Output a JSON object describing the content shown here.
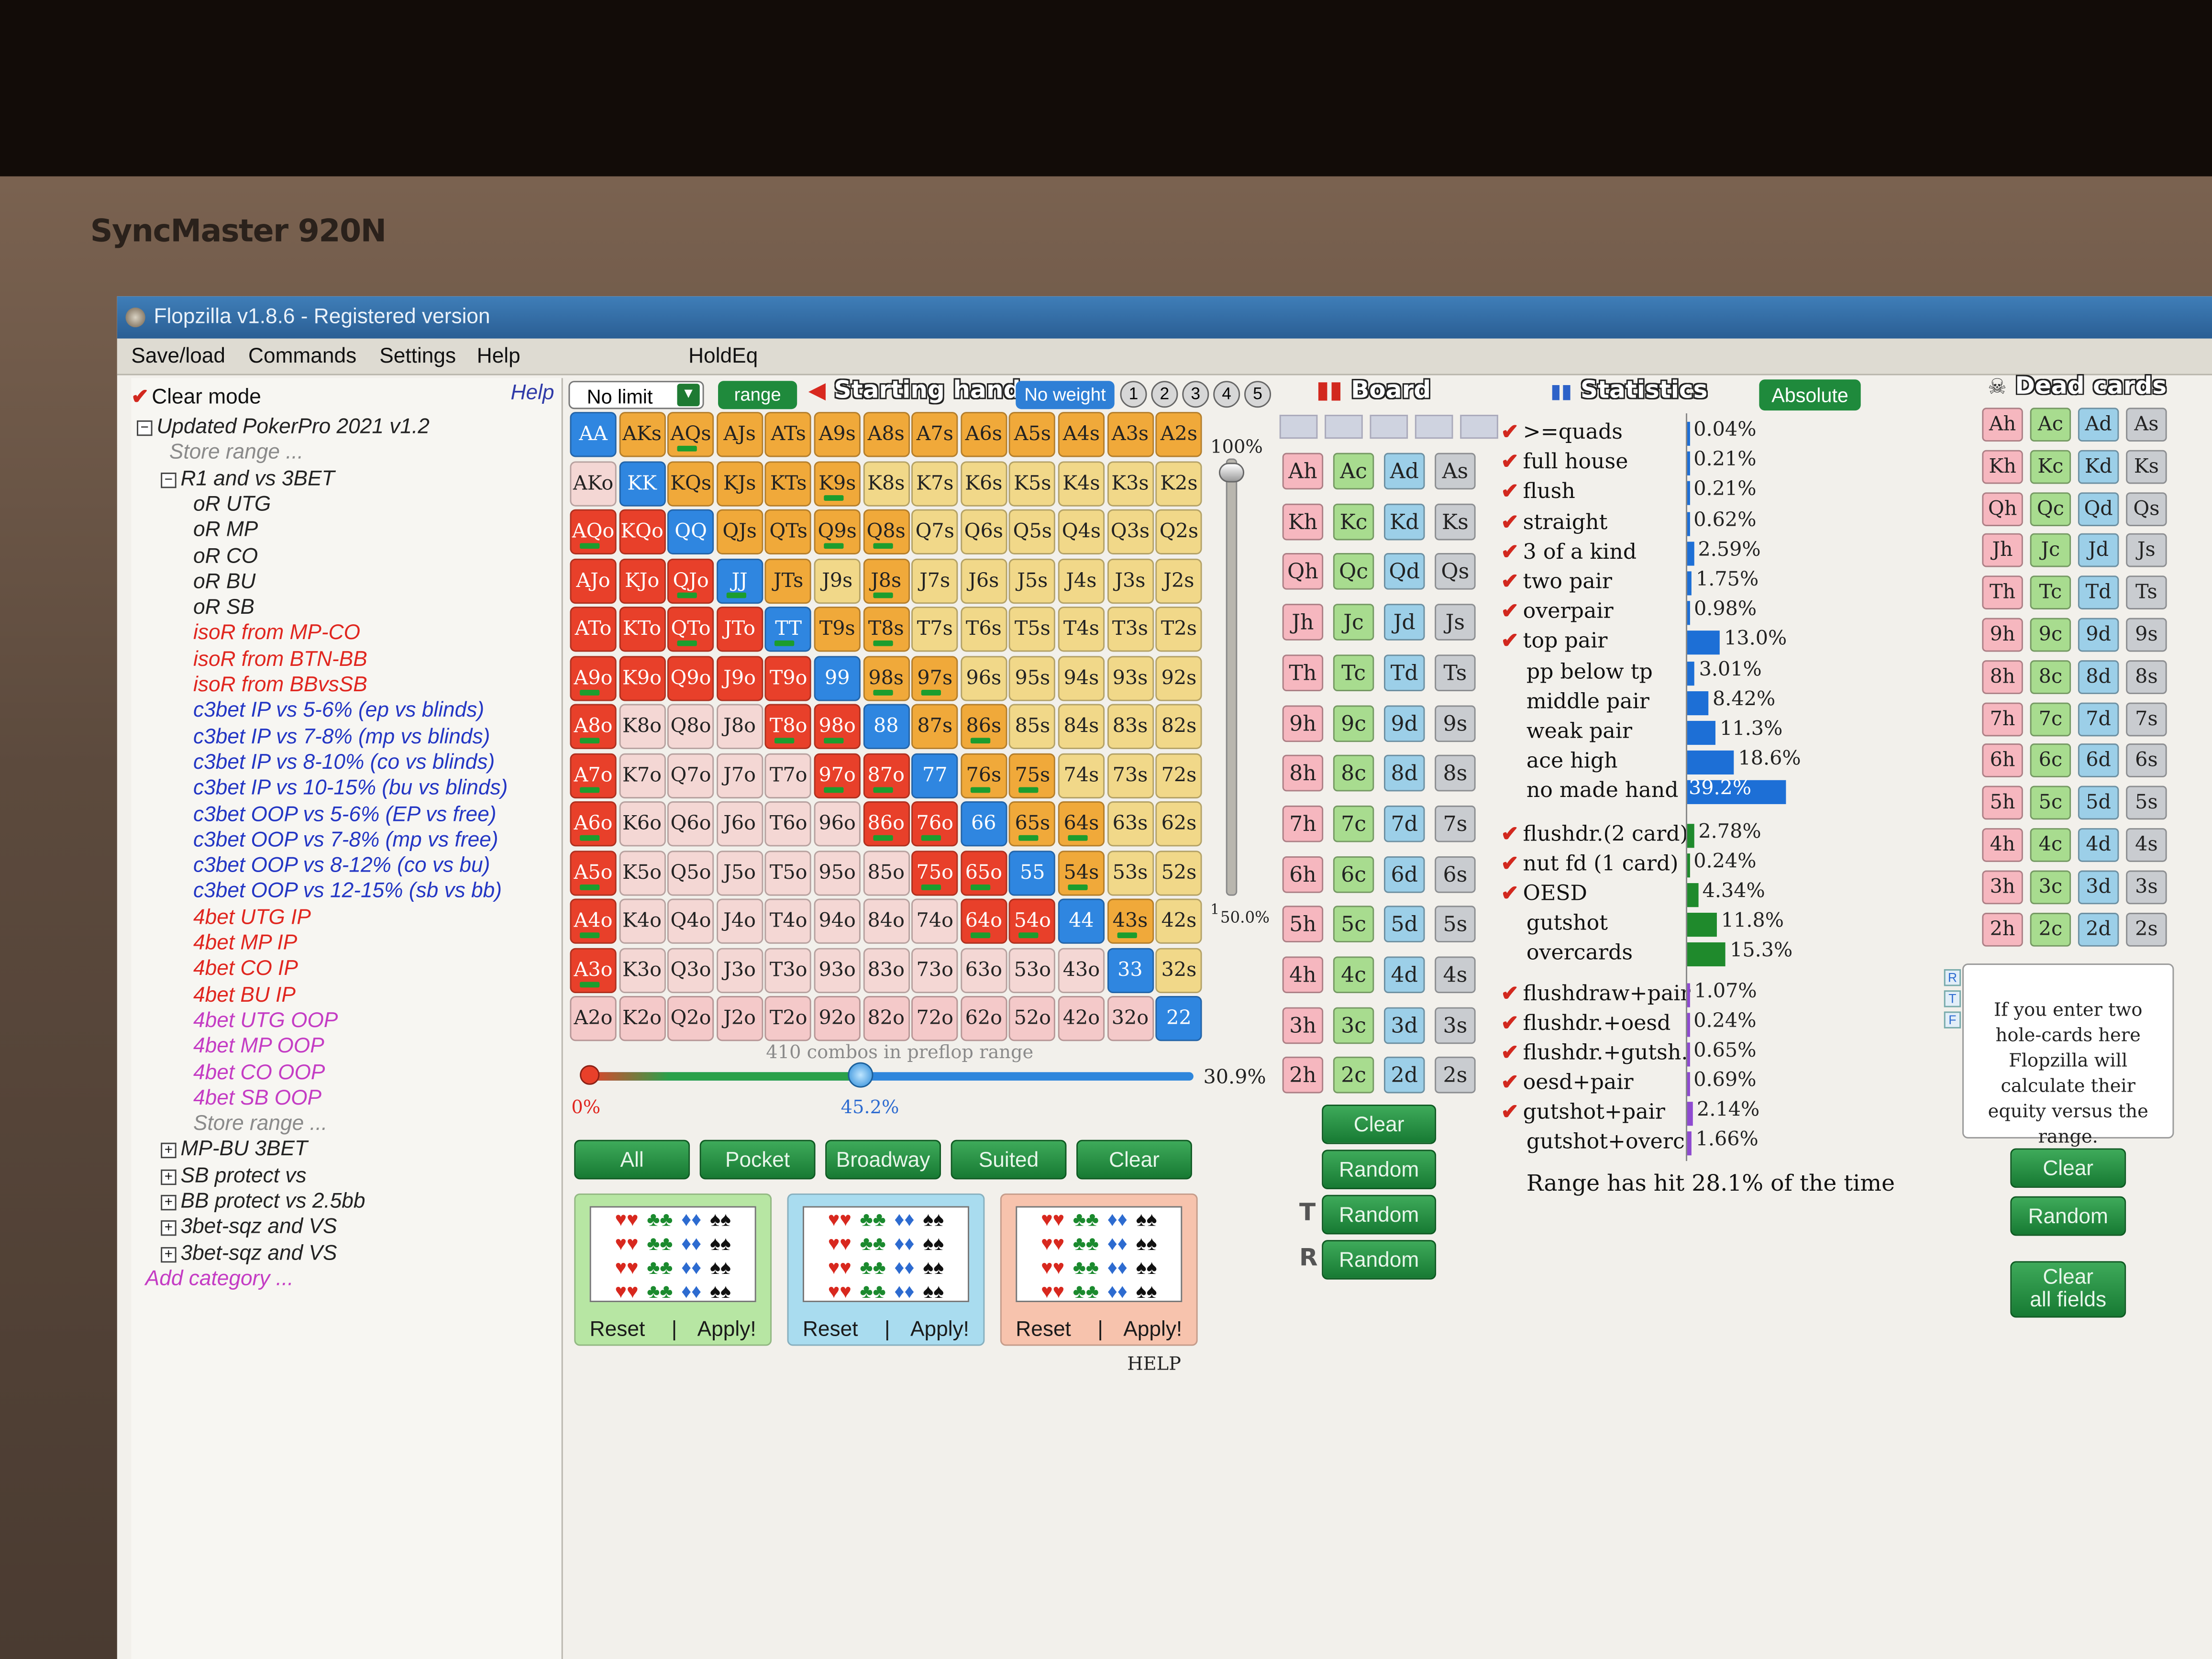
{
  "monitor": {
    "brand": "SyncMaster 920N"
  },
  "window": {
    "title": "Flopzilla v1.8.6 - Registered version"
  },
  "menu": [
    "Save/load",
    "Commands",
    "Settings",
    "Help",
    "HoldEq"
  ],
  "left_panel": {
    "clear_mode": "Clear mode",
    "help": "Help",
    "tree": [
      {
        "text": "Updated PokerPro 2021 v1.2",
        "color": "dark",
        "indent": 0,
        "box": "minus"
      },
      {
        "text": "Store range ...",
        "color": "gray",
        "indent": 1,
        "box": ""
      },
      {
        "text": "R1 and vs 3BET",
        "color": "dark",
        "indent": 1,
        "box": "minus"
      },
      {
        "text": "oR UTG",
        "color": "dark",
        "indent": 2,
        "box": ""
      },
      {
        "text": "oR MP",
        "color": "dark",
        "indent": 2,
        "box": ""
      },
      {
        "text": "oR CO",
        "color": "dark",
        "indent": 2,
        "box": ""
      },
      {
        "text": "oR BU",
        "color": "dark",
        "indent": 2,
        "box": ""
      },
      {
        "text": "oR SB",
        "color": "dark",
        "indent": 2,
        "box": ""
      },
      {
        "text": "isoR from MP-CO",
        "color": "red",
        "indent": 2,
        "box": ""
      },
      {
        "text": "isoR from BTN-BB",
        "color": "red",
        "indent": 2,
        "box": ""
      },
      {
        "text": "isoR from BBvsSB",
        "color": "red",
        "indent": 2,
        "box": ""
      },
      {
        "text": "c3bet IP vs 5-6% (ep vs blinds)",
        "color": "blue",
        "indent": 2,
        "box": ""
      },
      {
        "text": "c3bet IP vs 7-8% (mp vs blinds)",
        "color": "blue",
        "indent": 2,
        "box": ""
      },
      {
        "text": "c3bet IP vs 8-10% (co vs blinds)",
        "color": "blue",
        "indent": 2,
        "box": ""
      },
      {
        "text": "c3bet IP vs 10-15% (bu vs blinds)",
        "color": "blue",
        "indent": 2,
        "box": ""
      },
      {
        "text": "c3bet OOP vs 5-6% (EP vs free)",
        "color": "blue",
        "indent": 2,
        "box": ""
      },
      {
        "text": "c3bet OOP vs 7-8% (mp vs free)",
        "color": "blue",
        "indent": 2,
        "box": ""
      },
      {
        "text": "c3bet OOP vs 8-12% (co vs bu)",
        "color": "blue",
        "indent": 2,
        "box": ""
      },
      {
        "text": "c3bet OOP vs 12-15% (sb vs bb)",
        "color": "blue",
        "indent": 2,
        "box": ""
      },
      {
        "text": "4bet UTG IP",
        "color": "red",
        "indent": 2,
        "box": ""
      },
      {
        "text": "4bet MP IP",
        "color": "red",
        "indent": 2,
        "box": ""
      },
      {
        "text": "4bet CO IP",
        "color": "red",
        "indent": 2,
        "box": ""
      },
      {
        "text": "4bet BU IP",
        "color": "red",
        "indent": 2,
        "box": ""
      },
      {
        "text": "4bet UTG OOP",
        "color": "pink",
        "indent": 2,
        "box": ""
      },
      {
        "text": "4bet MP OOP",
        "color": "pink",
        "indent": 2,
        "box": ""
      },
      {
        "text": "4bet CO OOP",
        "color": "pink",
        "indent": 2,
        "box": ""
      },
      {
        "text": "4bet SB OOP",
        "color": "pink",
        "indent": 2,
        "box": ""
      },
      {
        "text": "Store range ...",
        "color": "gray",
        "indent": 2,
        "box": ""
      },
      {
        "text": "MP-BU 3BET",
        "color": "dark",
        "indent": 1,
        "box": "plus"
      },
      {
        "text": "SB protect vs",
        "color": "dark",
        "indent": 1,
        "box": "plus"
      },
      {
        "text": "BB protect vs 2.5bb",
        "color": "dark",
        "indent": 1,
        "box": "plus"
      },
      {
        "text": "3bet-sqz and VS",
        "color": "dark",
        "indent": 1,
        "box": "plus"
      },
      {
        "text": "3bet-sqz and VS",
        "color": "dark",
        "indent": 1,
        "box": "plus"
      },
      {
        "text": "Add category ...",
        "color": "pink",
        "indent": 0,
        "box": ""
      }
    ]
  },
  "range_panel": {
    "game_type": "No limit",
    "range_btn": "range",
    "title": "Starting hand",
    "weight_btn": "No weight",
    "weight_levels": [
      "1",
      "2",
      "3",
      "4",
      "5"
    ],
    "combos_text": "410 combos in preflop range",
    "slider_min": "0%",
    "slider_value": "45.2%",
    "slider_right": "30.9%",
    "slider_fraction": 0.452,
    "vslider_top": "100%",
    "vslider_bottom": "50.0%",
    "vslider_small": "1",
    "buttons": [
      "All",
      "Pocket",
      "Broadway",
      "Suited",
      "Clear"
    ],
    "suit_panels": [
      {
        "reset": "Reset",
        "apply": "Apply!",
        "bg": "#b7e6a3"
      },
      {
        "reset": "Reset",
        "apply": "Apply!",
        "bg": "#a9dcef"
      },
      {
        "reset": "Reset",
        "apply": "Apply!",
        "bg": "#f7c3ad"
      }
    ],
    "help": "HELP",
    "colors": {
      "r": "#e8402a",
      "o": "#f0a93a",
      "b": "#2f86e0",
      "p": "#f4c9c9",
      "y": "#f1d889",
      "w": "#f4d7d4"
    },
    "rows": [
      "AA AKs AQs AJs ATs A9s A8s A7s A6s A5s A4s A3s A2s",
      "AKo KK KQs KJs KTs K9s K8s K7s K6s K5s K4s K3s K2s",
      "AQo KQo QQ QJs QTs Q9s Q8s Q7s Q6s Q5s Q4s Q3s Q2s",
      "AJo KJo QJo JJ JTs J9s J8s J7s J6s J5s J4s J3s J2s",
      "ATo KTo QTo JTo TT T9s T8s T7s T6s T5s T4s T3s T2s",
      "A9o K9o Q9o J9o T9o 99 98s 97s 96s 95s 94s 93s 92s",
      "A8o K8o Q8o J8o T8o 98o 88 87s 86s 85s 84s 83s 82s",
      "A7o K7o Q7o J7o T7o 97o 87o 77 76s 75s 74s 73s 72s",
      "A6o K6o Q6o J6o T6o 96o 86o 76o 66 65s 64s 63s 62s",
      "A5o K5o Q5o J5o T5o 95o 85o 75o 65o 55 54s 53s 52s",
      "A4o K4o Q4o J4o T4o 94o 84o 74o 64o 54o 44 43s 42s",
      "A3o K3o Q3o J3o T3o 93o 83o 73o 63o 53o 43o 33 32s",
      "A2o K2o Q2o J2o T2o 92o 82o 72o 62o 52o 42o 32o 22"
    ],
    "row_colors": [
      "b o o o o o o o o o o o o",
      "w b o o o o y y y y y y y",
      "r r b o o o o y y y y y y",
      "r r r b o y o y y y y y y",
      "r r r r b o o y y y y y y",
      "r r r r r b o o y y y y y",
      "r w w w r r b o o y y y y",
      "r w w w w r r b o o y y y",
      "r w w w w w r r b o o y y",
      "r w w w w w w r r b o y y",
      "r w w w w w w w r r b o y",
      "r w w w w w w w w w w b y",
      "p p p p p p p p p p p p b"
    ],
    "row_dash": [
      "0 0 1 0 0 0 0 0 0 0 0 0 0",
      "0 0 0 0 0 1 0 0 0 0 0 0 0",
      "1 0 0 0 0 1 1 0 0 0 0 0 0",
      "0 0 1 1 0 0 1 0 0 0 0 0 0",
      "0 0 1 0 1 0 1 0 0 0 0 0 0",
      "1 0 0 0 0 0 1 1 0 0 0 0 0",
      "1 0 0 0 1 1 0 0 1 0 0 0 0",
      "1 0 0 0 0 1 1 0 1 1 0 0 0",
      "1 0 0 0 0 0 1 1 0 1 1 0 0",
      "1 0 0 0 0 0 0 1 1 0 1 0 0",
      "1 0 0 0 0 0 0 0 1 1 0 1 0",
      "1 0 0 0 0 0 0 0 0 0 0 0 0",
      "0 0 0 0 0 0 0 0 0 0 0 0 0"
    ]
  },
  "board": {
    "title": "Board",
    "cards": [
      [
        "Ah",
        "Ac",
        "Ad",
        "As"
      ],
      [
        "Kh",
        "Kc",
        "Kd",
        "Ks"
      ],
      [
        "Qh",
        "Qc",
        "Qd",
        "Qs"
      ],
      [
        "Jh",
        "Jc",
        "Jd",
        "Js"
      ],
      [
        "Th",
        "Tc",
        "Td",
        "Ts"
      ],
      [
        "9h",
        "9c",
        "9d",
        "9s"
      ],
      [
        "8h",
        "8c",
        "8d",
        "8s"
      ],
      [
        "7h",
        "7c",
        "7d",
        "7s"
      ],
      [
        "6h",
        "6c",
        "6d",
        "6s"
      ],
      [
        "5h",
        "5c",
        "5d",
        "5s"
      ],
      [
        "4h",
        "4c",
        "4d",
        "4s"
      ],
      [
        "3h",
        "3c",
        "3d",
        "3s"
      ],
      [
        "2h",
        "2c",
        "2d",
        "2s"
      ]
    ],
    "clear": "Clear",
    "random": "Random",
    "turn_label": "T",
    "river_label": "R",
    "turn_random": "Random",
    "river_random": "Random"
  },
  "statistics": {
    "title": "Statistics",
    "mode_btn": "Absolute",
    "group1": [
      {
        "label": ">=quads",
        "value": "0.04%",
        "pct": 0.04,
        "checked": true
      },
      {
        "label": "full house",
        "value": "0.21%",
        "pct": 0.21,
        "checked": true
      },
      {
        "label": "flush",
        "value": "0.21%",
        "pct": 0.21,
        "checked": true
      },
      {
        "label": "straight",
        "value": "0.62%",
        "pct": 0.62,
        "checked": true
      },
      {
        "label": "3 of a kind",
        "value": "2.59%",
        "pct": 2.59,
        "checked": true
      },
      {
        "label": "two pair",
        "value": "1.75%",
        "pct": 1.75,
        "checked": true
      },
      {
        "label": "overpair",
        "value": "0.98%",
        "pct": 0.98,
        "checked": true
      },
      {
        "label": "top pair",
        "value": "13.0%",
        "pct": 13.0,
        "checked": true
      },
      {
        "label": "pp below tp",
        "value": "3.01%",
        "pct": 3.01,
        "checked": false
      },
      {
        "label": "middle pair",
        "value": "8.42%",
        "pct": 8.42,
        "checked": false
      },
      {
        "label": "weak pair",
        "value": "11.3%",
        "pct": 11.3,
        "checked": false
      },
      {
        "label": "ace high",
        "value": "18.6%",
        "pct": 18.6,
        "checked": false
      },
      {
        "label": "no made hand",
        "value": "39.2%",
        "pct": 39.2,
        "checked": false
      }
    ],
    "group2": [
      {
        "label": "flushdr.(2 card)",
        "value": "2.78%",
        "pct": 2.78,
        "checked": true
      },
      {
        "label": "nut fd (1 card)",
        "value": "0.24%",
        "pct": 0.24,
        "checked": true
      },
      {
        "label": "OESD",
        "value": "4.34%",
        "pct": 4.34,
        "checked": true
      },
      {
        "label": "gutshot",
        "value": "11.8%",
        "pct": 11.8,
        "checked": false
      },
      {
        "label": "overcards",
        "value": "15.3%",
        "pct": 15.3,
        "checked": false
      }
    ],
    "group3": [
      {
        "label": "flushdraw+pair",
        "value": "1.07%",
        "pct": 1.07,
        "checked": true
      },
      {
        "label": "flushdr.+oesd",
        "value": "0.24%",
        "pct": 0.24,
        "checked": true
      },
      {
        "label": "flushdr.+gutsh.",
        "value": "0.65%",
        "pct": 0.65,
        "checked": true
      },
      {
        "label": "oesd+pair",
        "value": "0.69%",
        "pct": 0.69,
        "checked": true
      },
      {
        "label": "gutshot+pair",
        "value": "2.14%",
        "pct": 2.14,
        "checked": true
      },
      {
        "label": "gutshot+overc.",
        "value": "1.66%",
        "pct": 1.66,
        "checked": false
      }
    ],
    "summary": "Range has hit 28.1% of the time"
  },
  "dead_cards": {
    "title": "Dead cards",
    "info": "If you enter two hole-cards here Flopzilla will calculate their equity versus the range.",
    "side_letters": [
      "R",
      "T",
      "F"
    ],
    "clear": "Clear",
    "random": "Random",
    "clear_all_1": "Clear",
    "clear_all_2": "all fields"
  }
}
